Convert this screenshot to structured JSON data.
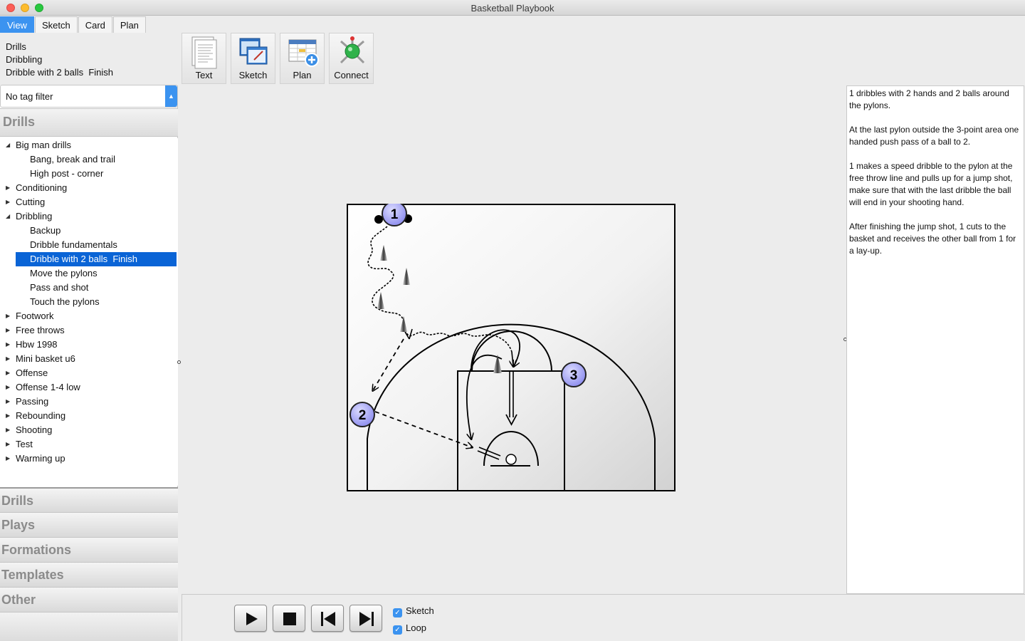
{
  "window": {
    "title": "Basketball Playbook"
  },
  "tabs": [
    {
      "label": "View",
      "active": true
    },
    {
      "label": "Sketch",
      "active": false
    },
    {
      "label": "Card",
      "active": false
    },
    {
      "label": "Plan",
      "active": false
    }
  ],
  "breadcrumb": [
    "Drills",
    "Dribbling",
    "Dribble with 2 balls  Finish"
  ],
  "tag_filter": {
    "value": "No tag filter"
  },
  "drills_header": "Drills",
  "tree": [
    {
      "label": "Big man drills",
      "level": 0,
      "expanded": true
    },
    {
      "label": "Bang, break and trail",
      "level": 1
    },
    {
      "label": "High post - corner",
      "level": 1
    },
    {
      "label": "Conditioning",
      "level": 0,
      "expanded": false
    },
    {
      "label": "Cutting",
      "level": 0,
      "expanded": false
    },
    {
      "label": "Dribbling",
      "level": 0,
      "expanded": true
    },
    {
      "label": "Backup",
      "level": 1
    },
    {
      "label": "Dribble fundamentals",
      "level": 1
    },
    {
      "label": "Dribble with 2 balls  Finish",
      "level": 1,
      "selected": true
    },
    {
      "label": "Move the pylons",
      "level": 1
    },
    {
      "label": "Pass and shot",
      "level": 1
    },
    {
      "label": "Touch the pylons",
      "level": 1
    },
    {
      "label": "Footwork",
      "level": 0,
      "expanded": false
    },
    {
      "label": "Free throws",
      "level": 0,
      "expanded": false
    },
    {
      "label": "Hbw 1998",
      "level": 0,
      "expanded": false
    },
    {
      "label": "Mini basket u6",
      "level": 0,
      "expanded": false
    },
    {
      "label": "Offense",
      "level": 0,
      "expanded": false
    },
    {
      "label": "Offense 1-4 low",
      "level": 0,
      "expanded": false
    },
    {
      "label": "Passing",
      "level": 0,
      "expanded": false
    },
    {
      "label": "Rebounding",
      "level": 0,
      "expanded": false
    },
    {
      "label": "Shooting",
      "level": 0,
      "expanded": false
    },
    {
      "label": "Test",
      "level": 0,
      "expanded": false
    },
    {
      "label": "Warming up",
      "level": 0,
      "expanded": false
    }
  ],
  "accordion": [
    "Drills",
    "Plays",
    "Formations",
    "Templates",
    "Other"
  ],
  "toolbar": [
    {
      "label": "Text",
      "icon": "text-document-icon"
    },
    {
      "label": "Sketch",
      "icon": "sketch-windows-icon"
    },
    {
      "label": "Plan",
      "icon": "plan-calendar-icon"
    },
    {
      "label": "Connect",
      "icon": "connect-network-icon"
    }
  ],
  "players": [
    {
      "number": "1"
    },
    {
      "number": "2"
    },
    {
      "number": "3"
    }
  ],
  "notes": [
    "1 dribbles with 2 hands and 2 balls around the pylons.",
    "At the last pylon outside the 3-point area one handed push pass of a ball to 2.",
    "1 makes a speed dribble to the pylon at the free throw line and pulls up for a jump shot, make sure that with the last dribble the ball will end in your shooting hand.",
    "After finishing the jump shot, 1 cuts to the basket and receives the other ball from 1 for a lay-up."
  ],
  "playback": {
    "buttons": [
      "play-icon",
      "stop-icon",
      "skip-back-icon",
      "skip-forward-icon"
    ],
    "sketch_checkbox": {
      "label": "Sketch",
      "checked": true
    },
    "loop_checkbox": {
      "label": "Loop",
      "checked": true
    }
  },
  "colors": {
    "accent": "#3b93f0",
    "selection": "#0a64d6",
    "player_fill": "#9b9bf0"
  }
}
